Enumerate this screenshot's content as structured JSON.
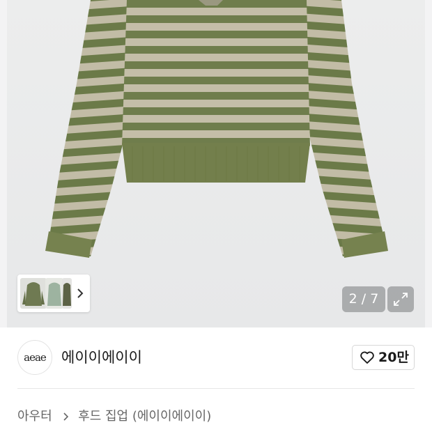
{
  "gallery": {
    "counter": "2 / 7",
    "icons": {
      "expand": "expand-icon",
      "next": "chevron-right-icon"
    },
    "thumbnails": [
      "green hoodie",
      "mint hoodie",
      "dark hoodie"
    ]
  },
  "shop": {
    "logo_text": "aeae",
    "name": "에이이에이이",
    "like_count": "20만",
    "like_icon": "heart-icon"
  },
  "breadcrumb": {
    "category": "아우터",
    "subcategory": "후드 집업 (에이이에이이)"
  },
  "colors": {
    "stripe_green": "#6f7d4c",
    "stripe_beige": "#c4bea8",
    "hero_bg": "#e9eaeb"
  }
}
